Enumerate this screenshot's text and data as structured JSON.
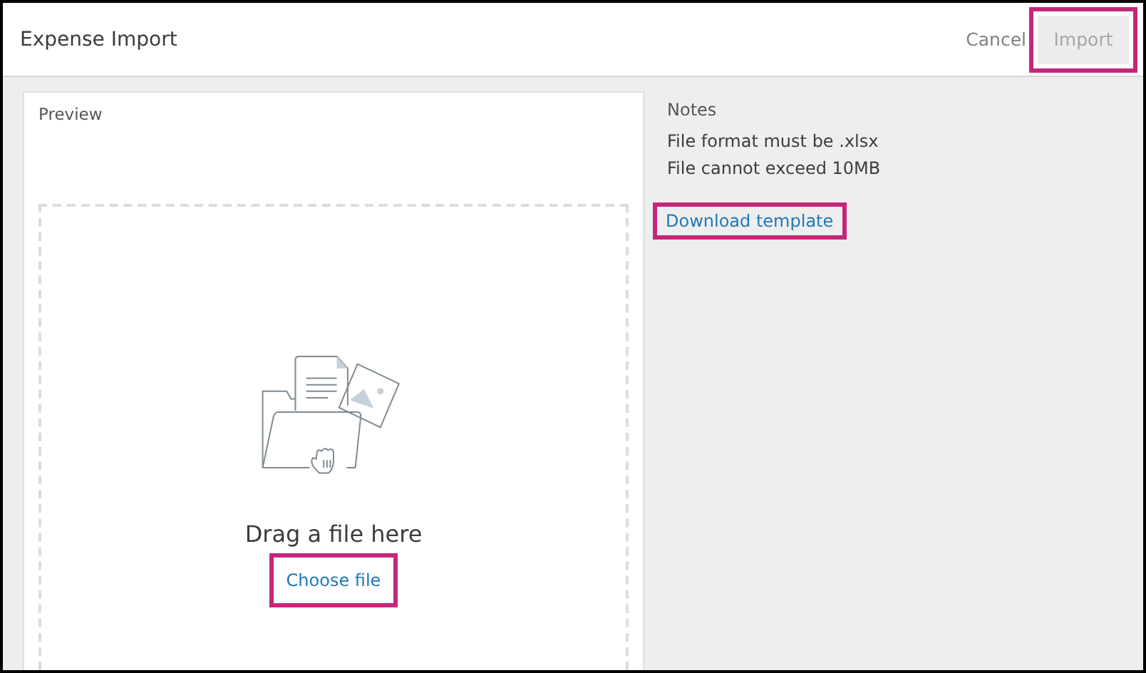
{
  "window": {
    "title": "Expense Import"
  },
  "header_actions": [
    {
      "label": "Cancel",
      "kind": "link",
      "disabled": false,
      "highlighted": false
    },
    {
      "label": "Import",
      "kind": "button",
      "disabled": true,
      "highlighted": true
    }
  ],
  "preview": {
    "title": "Preview",
    "dropzone": {
      "prompt": "Drag a file here",
      "action": {
        "label": "Choose file",
        "highlighted": true
      }
    }
  },
  "notes": {
    "title": "Notes",
    "lines": [
      "File format must be .xlsx",
      "File cannot exceed 10MB"
    ],
    "link": {
      "label": "Download template",
      "highlighted": true
    }
  }
}
